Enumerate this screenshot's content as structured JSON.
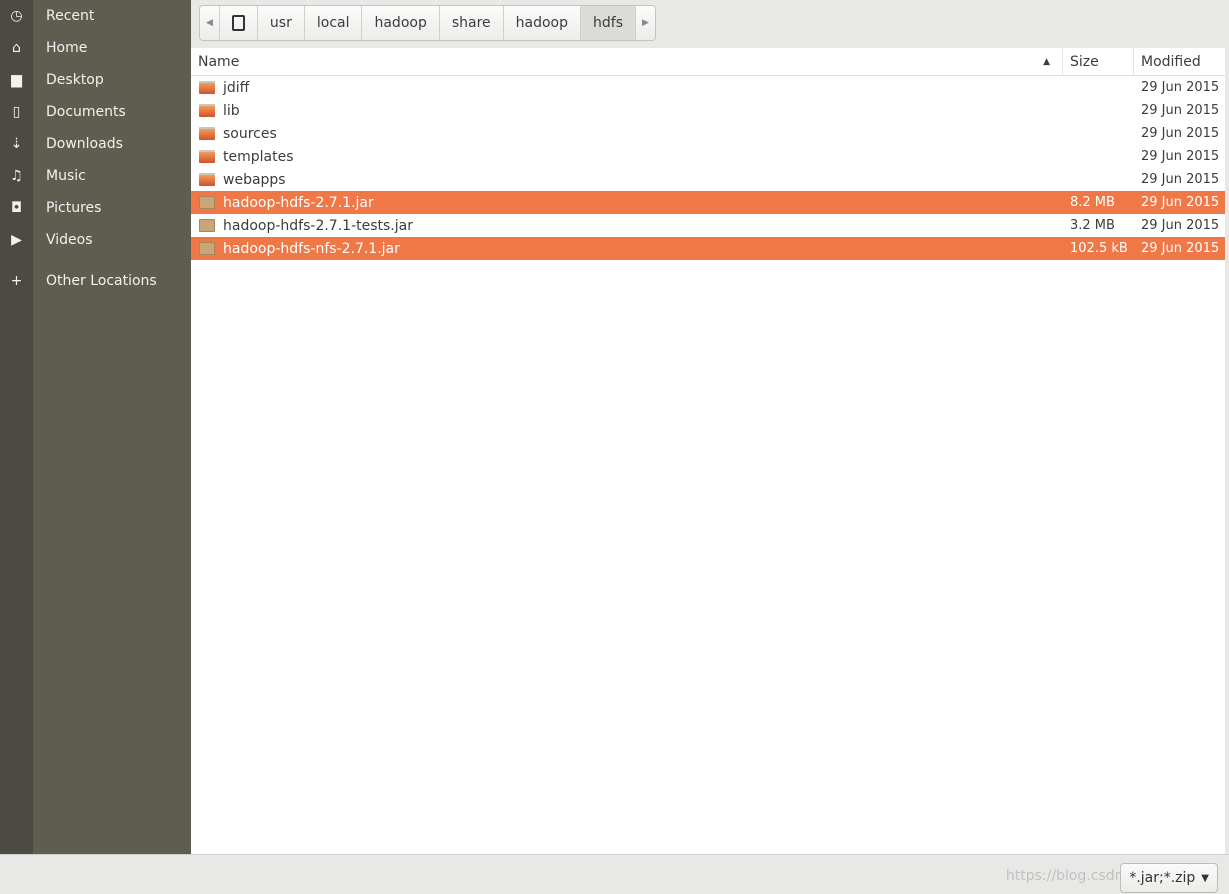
{
  "sidebar": {
    "items": [
      {
        "icon": "clock-icon",
        "glyph": "◷",
        "label": "Recent"
      },
      {
        "icon": "home-icon",
        "glyph": "⌂",
        "label": "Home"
      },
      {
        "icon": "folder-icon",
        "glyph": "▆",
        "label": "Desktop"
      },
      {
        "icon": "document-icon",
        "glyph": "▯",
        "label": "Documents"
      },
      {
        "icon": "download-icon",
        "glyph": "⇣",
        "label": "Downloads"
      },
      {
        "icon": "music-icon",
        "glyph": "♫",
        "label": "Music"
      },
      {
        "icon": "camera-icon",
        "glyph": "◘",
        "label": "Pictures"
      },
      {
        "icon": "video-icon",
        "glyph": "▶",
        "label": "Videos"
      },
      {
        "icon": "plus-icon",
        "glyph": "+",
        "label": "Other Locations"
      }
    ]
  },
  "breadcrumb": [
    "usr",
    "local",
    "hadoop",
    "share",
    "hadoop",
    "hdfs"
  ],
  "columns": {
    "name": "Name",
    "size": "Size",
    "modified": "Modified"
  },
  "files": [
    {
      "name": "jdiff",
      "type": "folder",
      "size": "",
      "modified": "29 Jun 2015",
      "selected": false
    },
    {
      "name": "lib",
      "type": "folder",
      "size": "",
      "modified": "29 Jun 2015",
      "selected": false
    },
    {
      "name": "sources",
      "type": "folder",
      "size": "",
      "modified": "29 Jun 2015",
      "selected": false
    },
    {
      "name": "templates",
      "type": "folder",
      "size": "",
      "modified": "29 Jun 2015",
      "selected": false
    },
    {
      "name": "webapps",
      "type": "folder",
      "size": "",
      "modified": "29 Jun 2015",
      "selected": false
    },
    {
      "name": "hadoop-hdfs-2.7.1.jar",
      "type": "jar",
      "size": "8.2 MB",
      "modified": "29 Jun 2015",
      "selected": true
    },
    {
      "name": "hadoop-hdfs-2.7.1-tests.jar",
      "type": "jar",
      "size": "3.2 MB",
      "modified": "29 Jun 2015",
      "selected": false
    },
    {
      "name": "hadoop-hdfs-nfs-2.7.1.jar",
      "type": "jar",
      "size": "102.5 kB",
      "modified": "29 Jun 2015",
      "selected": true
    }
  ],
  "filter": {
    "value": "*.jar;*.zip"
  },
  "watermark": "https://blog.csdn.net/...",
  "colors": {
    "selection": "#f07746",
    "sidebar": "#5f5c50"
  }
}
